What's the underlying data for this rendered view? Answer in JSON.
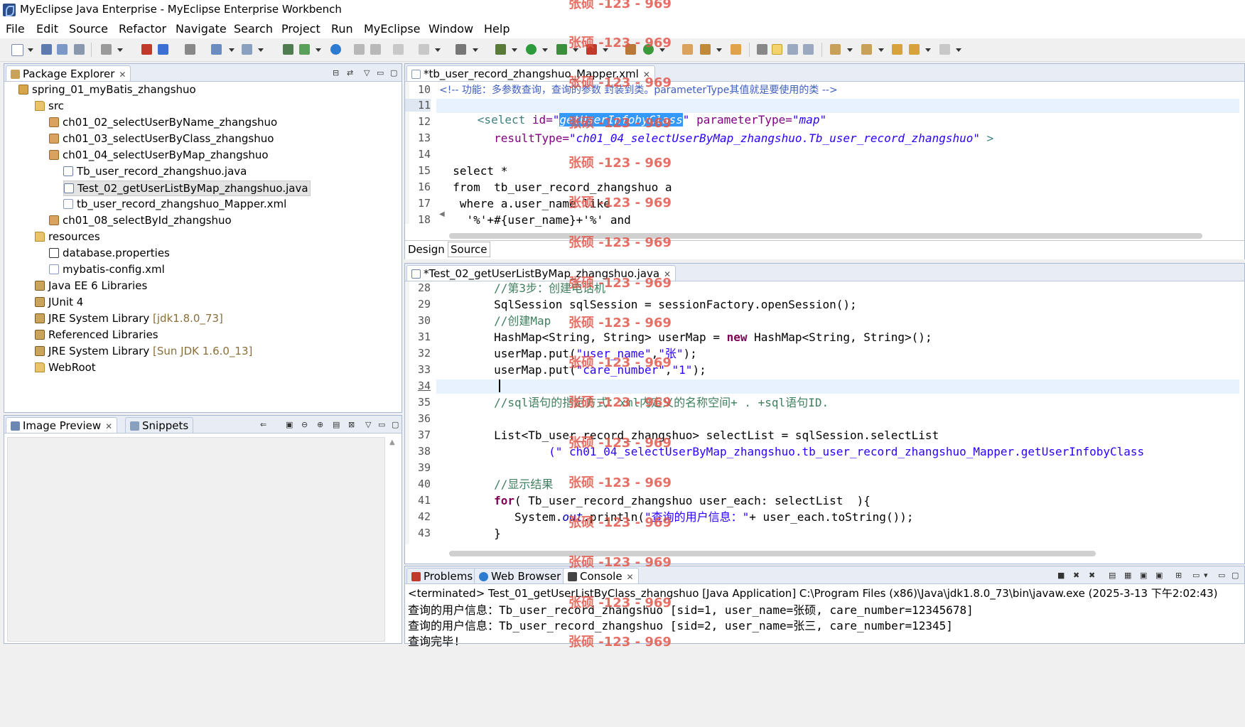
{
  "window": {
    "title": "MyEclipse Java Enterprise - MyEclipse Enterprise Workbench"
  },
  "menu": [
    "File",
    "Edit",
    "Source",
    "Refactor",
    "Navigate",
    "Search",
    "Project",
    "Run",
    "MyEclipse",
    "Window",
    "Help"
  ],
  "package_explorer": {
    "tab_label": "Package Explorer",
    "items": [
      {
        "label": "spring_01_myBatis_zhangshuo",
        "icon": "project-icon"
      },
      {
        "label": "src",
        "icon": "folder-icon"
      },
      {
        "label": "ch01_02_selectUserByName_zhangshuo",
        "icon": "package-icon"
      },
      {
        "label": "ch01_03_selectUserByClass_zhangshuo",
        "icon": "package-icon"
      },
      {
        "label": "ch01_04_selectUserByMap_zhangshuo",
        "icon": "package-icon"
      },
      {
        "label": "Tb_user_record_zhangshuo.java",
        "icon": "java-file-icon"
      },
      {
        "label": "Test_02_getUserListByMap_zhangshuo.java",
        "icon": "java-file-icon"
      },
      {
        "label": "tb_user_record_zhangshuo_Mapper.xml",
        "icon": "xml-file-icon"
      },
      {
        "label": "ch01_08_selectById_zhangshuo",
        "icon": "package-icon"
      },
      {
        "label": "resources",
        "icon": "folder-icon"
      },
      {
        "label": "database.properties",
        "icon": "properties-file-icon"
      },
      {
        "label": "mybatis-config.xml",
        "icon": "xml-file-icon"
      },
      {
        "label": "Java EE 6 Libraries",
        "icon": "library-icon"
      },
      {
        "label": "JUnit 4",
        "icon": "library-icon"
      },
      {
        "label": "JRE System Library",
        "decoration": "[jdk1.8.0_73]",
        "icon": "library-icon"
      },
      {
        "label": "Referenced Libraries",
        "icon": "library-icon"
      },
      {
        "label": "JRE System Library",
        "decoration": "[Sun JDK 1.6.0_13]",
        "icon": "library-icon"
      },
      {
        "label": "WebRoot",
        "icon": "folder-icon"
      }
    ]
  },
  "image_preview": {
    "tab_label": "Image Preview",
    "tab2_label": "Snippets"
  },
  "xml_editor": {
    "tab_label": "*tb_user_record_zhangshuo_Mapper.xml",
    "bottom_tabs": [
      "Design",
      "Source"
    ],
    "line_numbers": [
      "10",
      "11",
      "12",
      "13",
      "14",
      "15",
      "16",
      "17",
      "18"
    ],
    "lines": [
      "<!-- 功能：多参数查询，查询的参数 封装到类。parameterType其值就是要使用的类 -->",
      "<select id=\"getUserInfobyClass\" parameterType=\"map\"",
      "",
      "        resultType=\"ch01_04_selectUserByMap_zhangshuo.Tb_user_record_zhangshuo\" >",
      "",
      "  select *",
      "  from  tb_user_record_zhangshuo a",
      "   where a.user_name like",
      "    '%'+#{user_name}+'%' and"
    ],
    "selected_id": "getUserInfobyClass"
  },
  "java_editor": {
    "tab_label": "*Test_02_getUserListByMap_zhangshuo.java",
    "line_numbers": [
      "28",
      "29",
      "30",
      "31",
      "32",
      "33",
      "34",
      "35",
      "36",
      "37",
      "38",
      "39",
      "40",
      "41",
      "42",
      "43"
    ],
    "lines": [
      "        //第3步：创建电话机",
      "        SqlSession sqlSession = sessionFactory.openSession();",
      "        //创建Map",
      "        HashMap<String, String> userMap = new HashMap<String, String>();",
      "        userMap.put(\"user_name\",\"张\");",
      "        userMap.put(\"care_number\",\"1\");",
      "",
      "        //sql语句的指定方式：xml内定义的名称空间+ . +sql语句ID.",
      "",
      "        List<Tb_user_record_zhangshuo> selectList = sqlSession.selectList",
      "                (\" ch01_04_selectUserByMap_zhangshuo.tb_user_record_zhangshuo_Mapper.getUserInfobyClass",
      "",
      "        //显示结果",
      "        for( Tb_user_record_zhangshuo user_each: selectList  ){",
      "           System.out.println(\"查询的用户信息：\"+ user_each.toString());",
      "        }"
    ]
  },
  "bottom_panel": {
    "tabs": [
      "Problems",
      "Web Browser",
      "Console"
    ],
    "terminated_line": "<terminated> Test_01_getUserListByClass_zhangshuo [Java Application] C:\\Program Files (x86)\\Java\\jdk1.8.0_73\\bin\\javaw.exe (2025-3-13 下午2:02:43)",
    "output": [
      "查询的用户信息：Tb_user_record_zhangshuo [sid=1, user_name=张硕, care_number=12345678]",
      "查询的用户信息：Tb_user_record_zhangshuo [sid=2, user_name=张三, care_number=12345]",
      "查询完毕!"
    ]
  },
  "watermark": "张硕 -123 - 969"
}
